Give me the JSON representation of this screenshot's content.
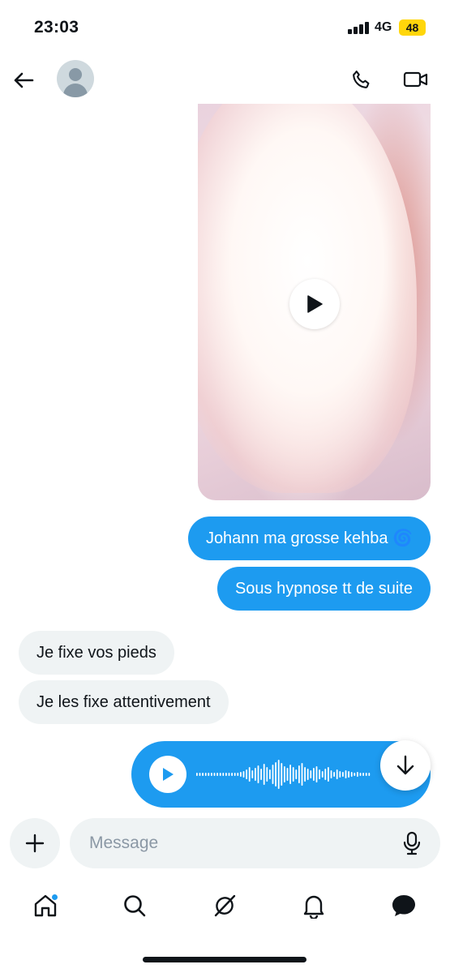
{
  "status_bar": {
    "time": "23:03",
    "network": "4G",
    "battery": "48",
    "battery_color": "#ffd60a"
  },
  "header": {
    "back_icon": "arrow-left-icon",
    "avatar": "default-avatar",
    "call_icon": "phone-icon",
    "video_icon": "video-camera-icon"
  },
  "messages": {
    "video": {
      "play_icon": "play-icon"
    },
    "outgoing_1": "Johann ma grosse kehba 🌀",
    "outgoing_2": "Sous hypnose tt de suite",
    "incoming_1": "Je fixe vos pieds",
    "incoming_2": "Je les fixe attentivement",
    "voice": {
      "play_icon": "play-icon",
      "waveform": "waveform"
    }
  },
  "scroll_down_icon": "arrow-down-icon",
  "composer": {
    "add_icon": "plus-icon",
    "placeholder": "Message",
    "mic_icon": "microphone-icon"
  },
  "bottom_nav": {
    "items": [
      "home-icon",
      "search-icon",
      "grok-icon",
      "bell-icon",
      "messages-icon"
    ],
    "home_has_notification": true
  },
  "colors": {
    "accent": "#1d9bf0",
    "incoming_bubble": "#eff3f4",
    "text": "#0f1419"
  }
}
